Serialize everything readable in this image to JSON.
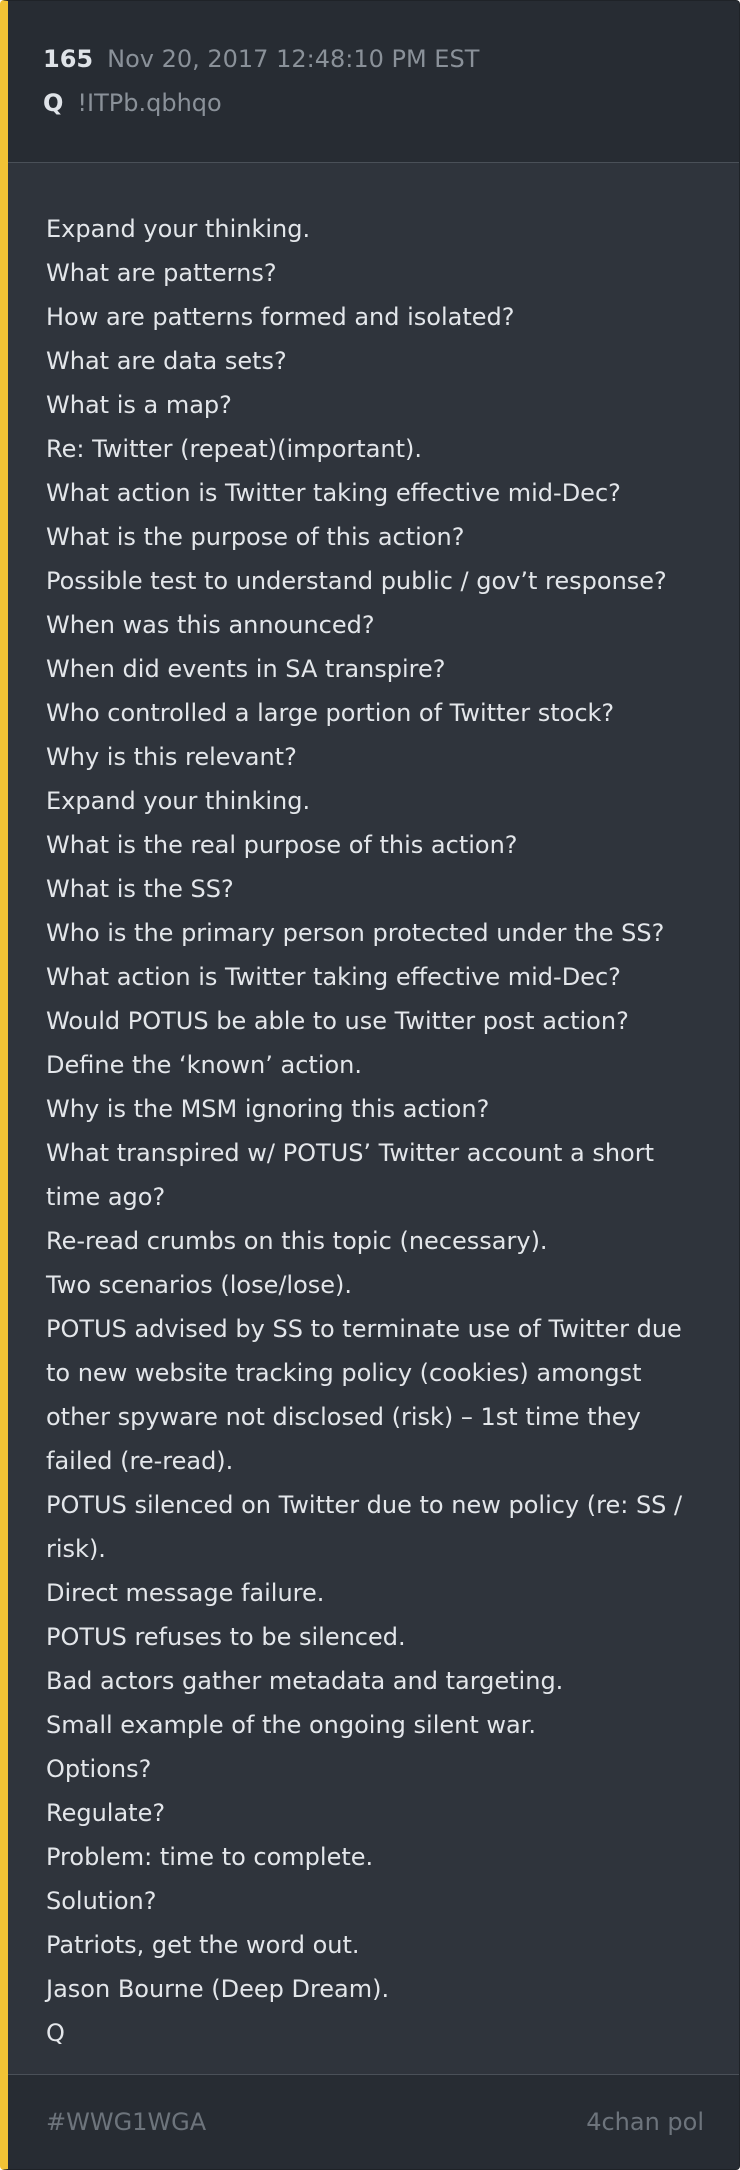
{
  "post": {
    "number": "165",
    "date": "Nov 20, 2017 12:48:10 PM EST",
    "author": "Q",
    "tripcode": "!ITPb.qbhqo"
  },
  "lines": [
    "Expand your thinking.",
    "What are patterns?",
    "How are patterns formed and isolated?",
    "What are data sets?",
    "What is a map?",
    "Re: Twitter (repeat)(important).",
    "What action is Twitter taking effective mid-Dec?",
    "What is the purpose of this action?",
    "Possible test to understand public / gov’t response?",
    "When was this announced?",
    "When did events in SA transpire?",
    "Who controlled a large portion of Twitter stock?",
    "Why is this relevant?",
    "Expand your thinking.",
    "What is the real purpose of this action?",
    "What is the SS?",
    "Who is the primary person protected under the SS?",
    "What action is Twitter taking effective mid-Dec?",
    "Would POTUS be able to use Twitter post action?",
    "Define the ‘known’ action.",
    "Why is the MSM ignoring this action?",
    "What transpired w/ POTUS’ Twitter account a short time ago?",
    "Re-read crumbs on this topic (necessary).",
    "Two scenarios (lose/lose).",
    "POTUS advised by SS to terminate use of Twitter due to new website tracking policy (cookies) amongst other spyware not disclosed (risk) – 1st time they failed (re-read).",
    "POTUS silenced on Twitter due to new policy (re: SS / risk).",
    "Direct message failure.",
    "POTUS refuses to be silenced.",
    "Bad actors gather metadata and targeting.",
    "Small example of the ongoing silent war.",
    "Options?",
    "Regulate?",
    "Problem: time to complete.",
    "Solution?",
    "Patriots, get the word out.",
    "Jason Bourne (Deep Dream).",
    "Q"
  ],
  "footer": {
    "hashtag": "#WWG1WGA",
    "source": "4chan pol"
  },
  "colors": {
    "accent": "#f2c335",
    "card_bg": "#2f343c",
    "header_bg": "#272c33",
    "text": "#e3e6ea",
    "muted": "#8a9199"
  }
}
